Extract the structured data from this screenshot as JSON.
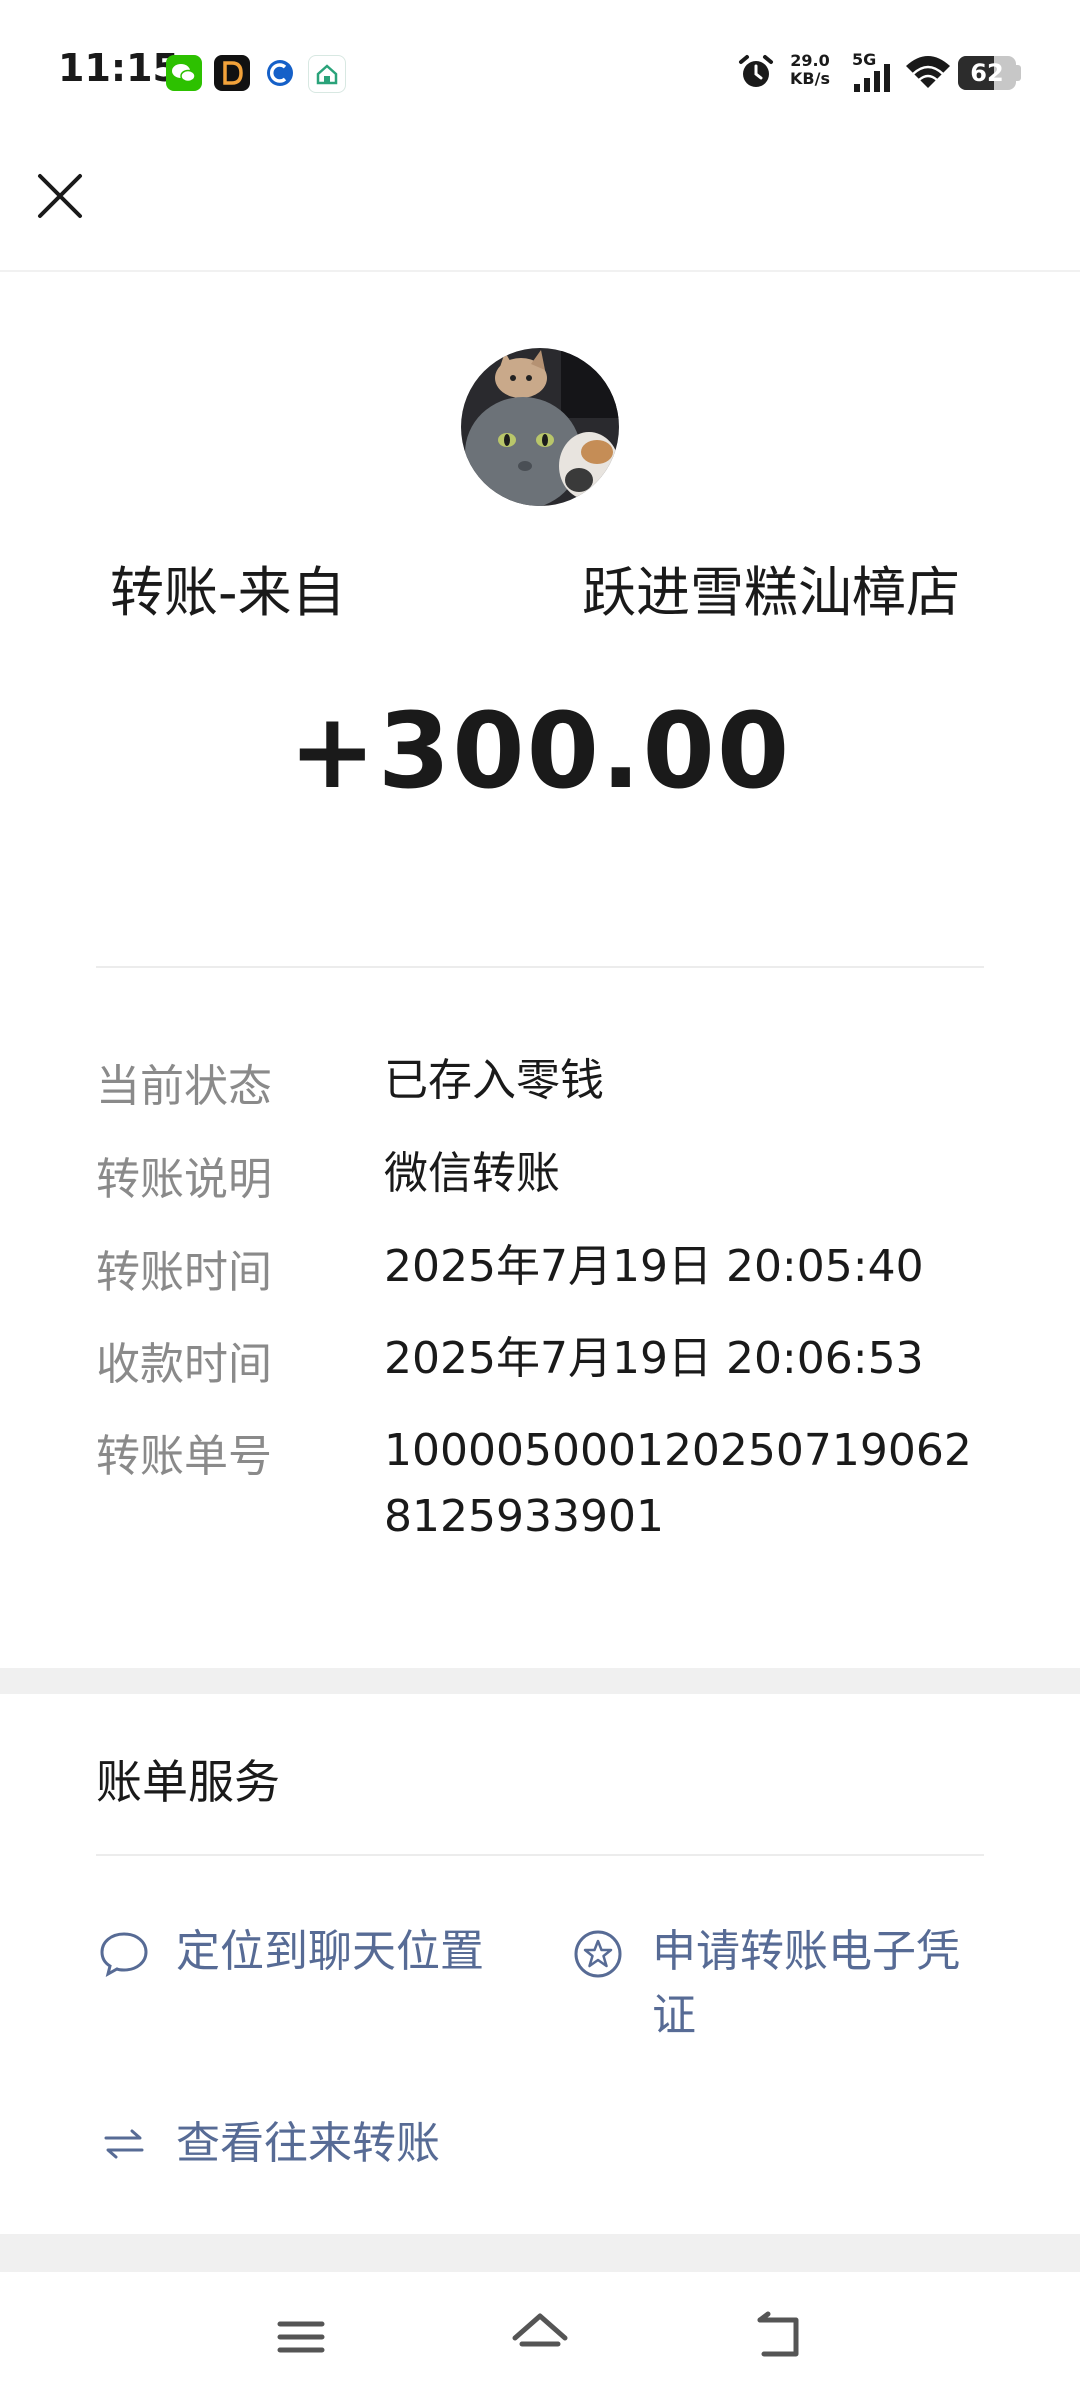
{
  "status_bar": {
    "time": "11:15",
    "network_speed_value": "29.0",
    "network_speed_unit": "KB/s",
    "network_type": "5G",
    "battery_level": "62",
    "battery_fraction": 0.62,
    "notification_icons": [
      "wechat-icon",
      "dianping-icon",
      "bank-app-icon",
      "home-app-icon"
    ]
  },
  "header": {
    "close_icon": "close-icon"
  },
  "transfer": {
    "from_prefix": "转账-来自",
    "from_name": "跃进雪糕汕樟店",
    "amount": "+300.00"
  },
  "details": [
    {
      "label": "当前状态",
      "value": "已存入零钱"
    },
    {
      "label": "转账说明",
      "value": "微信转账"
    },
    {
      "label": "转账时间",
      "value": "2025年7月19日 20:05:40"
    },
    {
      "label": "收款时间",
      "value": "2025年7月19日 20:06:53"
    },
    {
      "label": "转账单号",
      "value": "1000050001202507190628125933901"
    }
  ],
  "services": {
    "title": "账单服务",
    "items": [
      {
        "label": "定位到聊天位置",
        "icon": "chat-bubble-icon"
      },
      {
        "label": "申请转账电子凭证",
        "icon": "star-badge-icon"
      },
      {
        "label": "查看往来转账",
        "icon": "transfer-arrows-icon"
      }
    ]
  },
  "colors": {
    "link": "#576b95",
    "label": "#8a8a8a",
    "text": "#1a1a1a",
    "band": "#f0f0f0"
  }
}
